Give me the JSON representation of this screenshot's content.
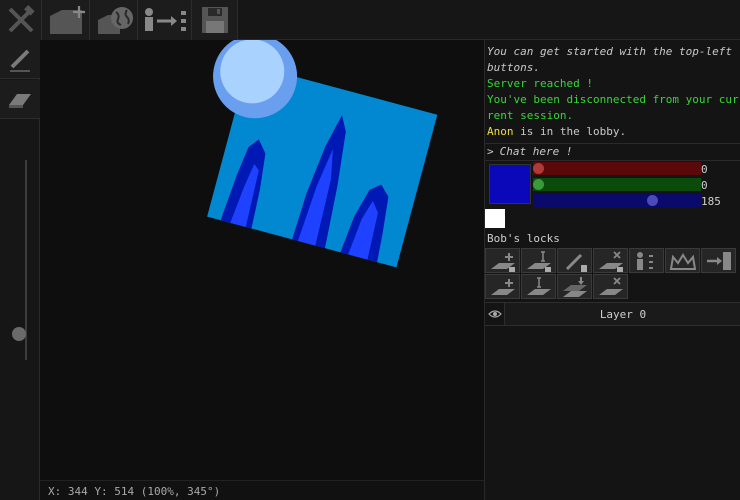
{
  "toolbar": {
    "buttons": [
      {
        "name": "tools-icon"
      },
      {
        "name": "new-image-icon"
      },
      {
        "name": "open-server-icon"
      },
      {
        "name": "share-session-icon"
      },
      {
        "name": "save-icon"
      }
    ]
  },
  "left_tools": {
    "brush_icon": "pencil-icon",
    "eraser_icon": "eraser-icon",
    "size_slider_value": 0.13
  },
  "canvas": {
    "status": "X: 344 Y: 514 (100%, 345°)",
    "colors": {
      "sky": "#0288d1",
      "sun_outer": "#6a9ff0",
      "sun_inner": "#aad2ff",
      "spire_dark": "#0019b4",
      "spire_bright": "#1e42ff"
    }
  },
  "chat": {
    "messages": [
      {
        "type": "info",
        "text": "You can get started with the top-left buttons."
      },
      {
        "type": "green",
        "text": "Server reached !"
      },
      {
        "type": "green",
        "text": "You've been disconnected from your current session."
      },
      {
        "type": "user",
        "name": "Anon",
        "text": " is in the lobby."
      }
    ],
    "prompt": ">",
    "placeholder": "Chat here !"
  },
  "color": {
    "current": "#0a08b9",
    "secondary": "#ffffff",
    "channels": [
      {
        "name": "red",
        "value": 0,
        "max": 255,
        "bar": "#5a0808",
        "knob": "#b03a3a"
      },
      {
        "name": "green",
        "value": 0,
        "max": 255,
        "bar": "#0a4a0a",
        "knob": "#3a9a3a"
      },
      {
        "name": "blue",
        "value": 185,
        "max": 255,
        "bar": "#0a0a6a",
        "knob": "#4a4ab8"
      }
    ]
  },
  "locks": {
    "title": "Bob's locks",
    "row1": [
      "lock-add-layer-icon",
      "lock-rename-layer-icon",
      "lock-draw-icon",
      "lock-delete-layer-icon",
      "user-broadcast-icon",
      "crown-icon",
      "exit-door-icon"
    ],
    "row2": [
      "add-layer-icon",
      "rename-layer-icon",
      "merge-down-icon",
      "delete-layer-icon"
    ]
  },
  "layers": [
    {
      "name": "Layer 0",
      "visible": true
    }
  ]
}
